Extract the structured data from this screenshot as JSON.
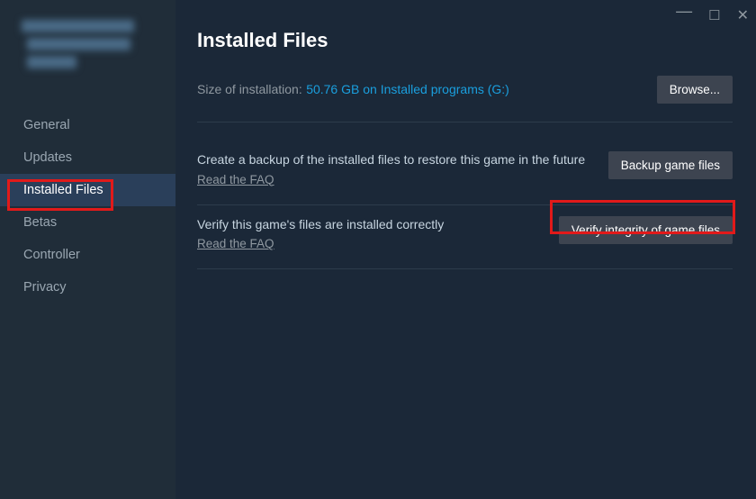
{
  "window": {
    "minimize": "—",
    "maximize": "☐",
    "close": "✕"
  },
  "sidebar": {
    "items": [
      {
        "label": "General"
      },
      {
        "label": "Updates"
      },
      {
        "label": "Installed Files"
      },
      {
        "label": "Betas"
      },
      {
        "label": "Controller"
      },
      {
        "label": "Privacy"
      }
    ]
  },
  "main": {
    "title": "Installed Files",
    "size_label": "Size of installation:",
    "size_value": "50.76 GB on Installed programs (G:)",
    "browse_btn": "Browse...",
    "backup": {
      "desc": "Create a backup of the installed files to restore this game in the future",
      "faq": "Read the FAQ",
      "btn": "Backup game files"
    },
    "verify": {
      "desc": "Verify this game's files are installed correctly",
      "faq": "Read the FAQ",
      "btn": "Verify integrity of game files"
    }
  }
}
